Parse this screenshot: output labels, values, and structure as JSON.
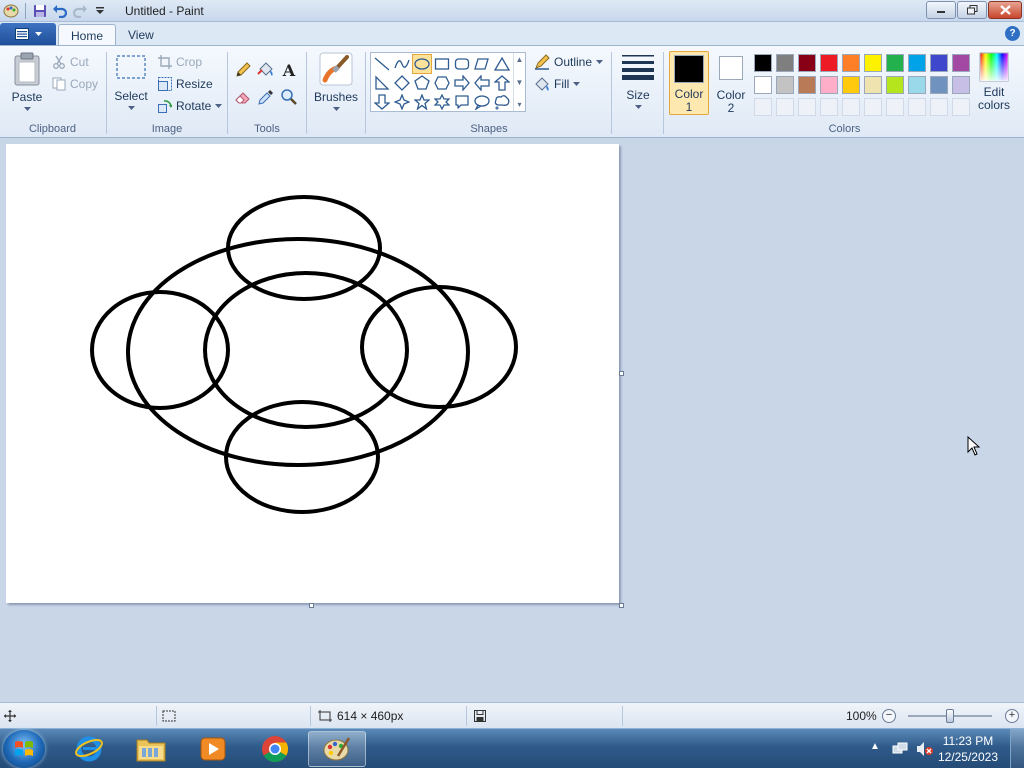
{
  "window": {
    "title": "Untitled - Paint",
    "minimize_icon": "minimize-icon",
    "restore_icon": "restore-icon",
    "close_icon": "close-icon"
  },
  "tabs": {
    "home": "Home",
    "view": "View"
  },
  "clipboard": {
    "paste": "Paste",
    "cut": "Cut",
    "copy": "Copy",
    "label": "Clipboard"
  },
  "image": {
    "select": "Select",
    "crop": "Crop",
    "resize": "Resize",
    "rotate": "Rotate",
    "label": "Image"
  },
  "tools": {
    "label": "Tools"
  },
  "brushes": {
    "label": "Brushes"
  },
  "shapes": {
    "outline": "Outline",
    "fill": "Fill",
    "label": "Shapes",
    "selected": "oval"
  },
  "size": {
    "label": "Size"
  },
  "colors": {
    "color1_line1": "Color",
    "color1_line2": "1",
    "color2_line1": "Color",
    "color2_line2": "2",
    "edit_line1": "Edit",
    "edit_line2": "colors",
    "label": "Colors",
    "color1_value": "#000000",
    "color2_value": "#ffffff",
    "palette_row1": [
      "#000000",
      "#7f7f7f",
      "#880015",
      "#ed1c24",
      "#ff7f27",
      "#fff200",
      "#22b14c",
      "#00a2e8",
      "#3f48cc",
      "#a349a4"
    ],
    "palette_row2": [
      "#ffffff",
      "#c3c3c3",
      "#b97a57",
      "#ffaec9",
      "#ffc90e",
      "#efe4b0",
      "#b5e61d",
      "#99d9ea",
      "#7092be",
      "#c8bfe7"
    ]
  },
  "status": {
    "dimensions": "614 × 460px",
    "zoom": "100%"
  },
  "taskbar": {
    "time": "11:23 PM",
    "date": "12/25/2023"
  }
}
